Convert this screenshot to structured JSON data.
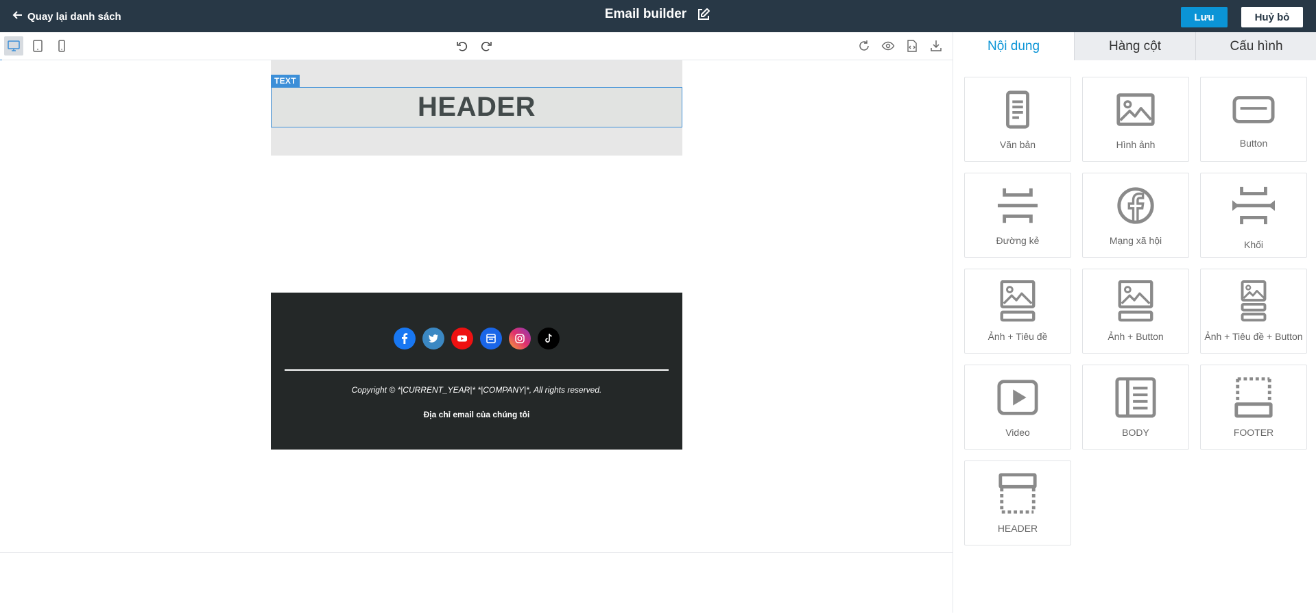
{
  "topbar": {
    "back_label": "Quay lại danh sách",
    "title": "Email builder",
    "save_label": "Lưu",
    "cancel_label": "Huỷ bỏ"
  },
  "canvas": {
    "tag_label": "TEXT",
    "header_text": "HEADER",
    "copyright": "Copyright © *|CURRENT_YEAR|* *|COMPANY|*, All rights reserved.",
    "address": "Địa chỉ email của chúng tôi",
    "socials": [
      {
        "icon": "facebook-icon",
        "color": "#1877f2"
      },
      {
        "icon": "twitter-icon",
        "color": "#3b88c3"
      },
      {
        "icon": "youtube-icon",
        "color": "#ee1111"
      },
      {
        "icon": "website-icon",
        "color": "#1a66e8"
      },
      {
        "icon": "instagram-icon",
        "color": "#c13584"
      },
      {
        "icon": "tiktok-icon",
        "color": "#000000"
      }
    ]
  },
  "colors": {
    "topbar_bg": "#283846",
    "primary": "#0b94d6",
    "selection": "#3c8fd8",
    "footer_bg": "#242828"
  },
  "panel": {
    "tabs": [
      {
        "label": "Nội dung",
        "active": true
      },
      {
        "label": "Hàng cột",
        "active": false
      },
      {
        "label": "Cấu hình",
        "active": false
      }
    ],
    "blocks": [
      {
        "label": "Văn bản",
        "icon": "text-document-icon"
      },
      {
        "label": "Hình ảnh",
        "icon": "image-icon"
      },
      {
        "label": "Button",
        "icon": "button-icon"
      },
      {
        "label": "Đường kẻ",
        "icon": "divider-icon"
      },
      {
        "label": "Mạng xã hội",
        "icon": "facebook-circle-icon"
      },
      {
        "label": "Khối",
        "icon": "spacer-icon"
      },
      {
        "label": "Ảnh + Tiêu đề",
        "icon": "image-title-icon"
      },
      {
        "label": "Ảnh + Button",
        "icon": "image-button-icon"
      },
      {
        "label": "Ảnh + Tiêu đề + Button",
        "icon": "image-title-button-icon"
      },
      {
        "label": "Video",
        "icon": "video-icon"
      },
      {
        "label": "BODY",
        "icon": "body-icon"
      },
      {
        "label": "FOOTER",
        "icon": "footer-icon"
      },
      {
        "label": "HEADER",
        "icon": "header-icon"
      }
    ]
  }
}
